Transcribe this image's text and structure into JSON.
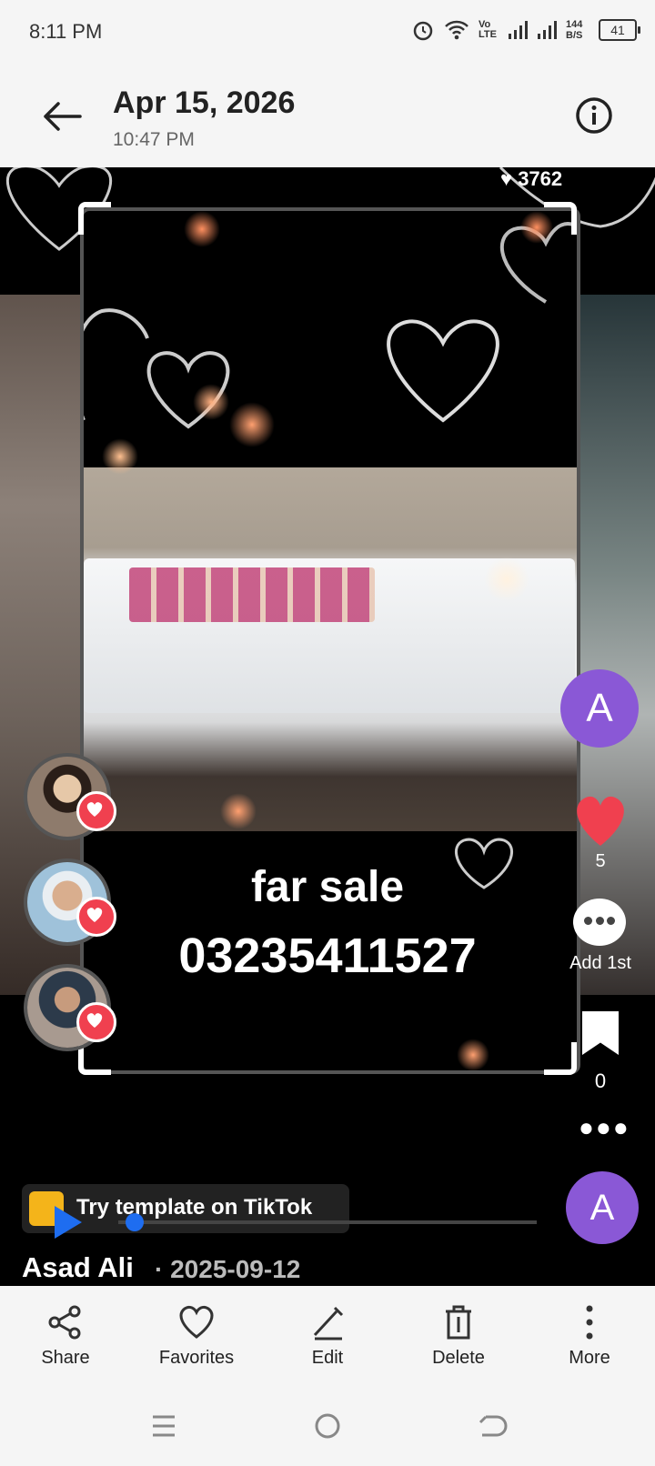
{
  "status_bar": {
    "time": "8:11 PM",
    "network_label": "Vo LTE",
    "speed": "144 B/S",
    "battery": "41"
  },
  "header": {
    "title": "Apr 15, 2026",
    "subtitle": "10:47 PM"
  },
  "video": {
    "overlay_line1": "far sale",
    "overlay_line2": "03235411527",
    "top_count": "3762",
    "like_count": "5",
    "comment_label": "Add 1st",
    "save_count": "0",
    "creator_initial": "A",
    "template_label": "Try template on TikTok",
    "author": "Asad Ali",
    "date_separator": "·",
    "date": "2025-09-12",
    "bottom_avatar_initial": "A"
  },
  "toolbar": {
    "items": [
      {
        "label": "Share",
        "icon": "share-icon"
      },
      {
        "label": "Favorites",
        "icon": "heart-icon"
      },
      {
        "label": "Edit",
        "icon": "pencil-icon"
      },
      {
        "label": "Delete",
        "icon": "trash-icon"
      },
      {
        "label": "More",
        "icon": "more-vertical-icon"
      }
    ]
  },
  "colors": {
    "accent_purple": "#8a58d6",
    "like_red": "#f0404f",
    "seek_blue": "#1e6df0"
  }
}
